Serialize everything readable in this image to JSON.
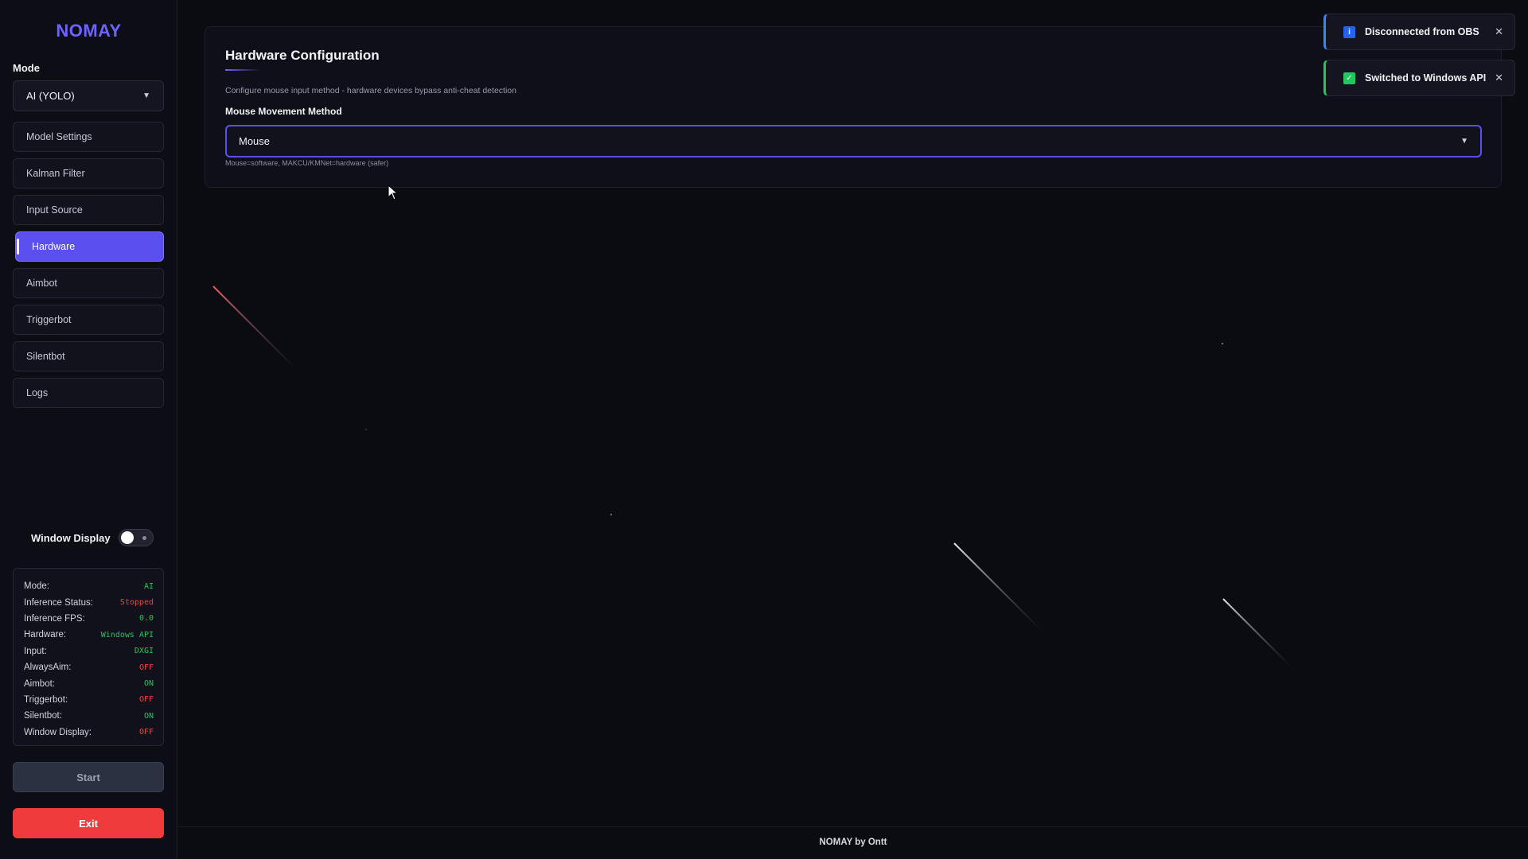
{
  "app": {
    "name": "NOMAY",
    "footer": "NOMAY by Ontt"
  },
  "sidebar": {
    "mode_label": "Mode",
    "mode_value": "AI (YOLO)",
    "items": [
      {
        "label": "Model Settings",
        "active": false
      },
      {
        "label": "Kalman Filter",
        "active": false
      },
      {
        "label": "Input Source",
        "active": false
      },
      {
        "label": "Hardware",
        "active": true
      },
      {
        "label": "Aimbot",
        "active": false
      },
      {
        "label": "Triggerbot",
        "active": false
      },
      {
        "label": "Silentbot",
        "active": false
      },
      {
        "label": "Logs",
        "active": false
      }
    ],
    "window_display_label": "Window Display",
    "window_display_on": false,
    "status": [
      {
        "key": "Mode:",
        "value": "AI",
        "color": "green"
      },
      {
        "key": "Inference Status:",
        "value": "Stopped",
        "color": "red"
      },
      {
        "key": "Inference FPS:",
        "value": "0.0",
        "color": "green"
      },
      {
        "key": "Hardware:",
        "value": "Windows API",
        "color": "green"
      },
      {
        "key": "Input:",
        "value": "DXGI",
        "color": "green"
      },
      {
        "key": "AlwaysAim:",
        "value": "OFF",
        "color": "red"
      },
      {
        "key": "Aimbot:",
        "value": "ON",
        "color": "green"
      },
      {
        "key": "Triggerbot:",
        "value": "OFF",
        "color": "red"
      },
      {
        "key": "Silentbot:",
        "value": "ON",
        "color": "green"
      },
      {
        "key": "Window Display:",
        "value": "OFF",
        "color": "red"
      }
    ],
    "start_label": "Start",
    "exit_label": "Exit"
  },
  "main": {
    "title": "Hardware Configuration",
    "description": "Configure mouse input method - hardware devices bypass anti-cheat detection",
    "field_label": "Mouse Movement Method",
    "method_value": "Mouse",
    "hint": "Mouse=software, MAKCU/KMNet=hardware (safer)"
  },
  "toasts": [
    {
      "type": "info",
      "text": "Disconnected from OBS",
      "icon": "info-icon"
    },
    {
      "type": "success",
      "text": "Switched to Windows API",
      "icon": "check-icon"
    }
  ],
  "colors": {
    "accent": "#5b4ff0",
    "brand": "#6f62ff",
    "success": "#22c55e",
    "danger": "#ef4444",
    "info": "#3b82f6"
  }
}
